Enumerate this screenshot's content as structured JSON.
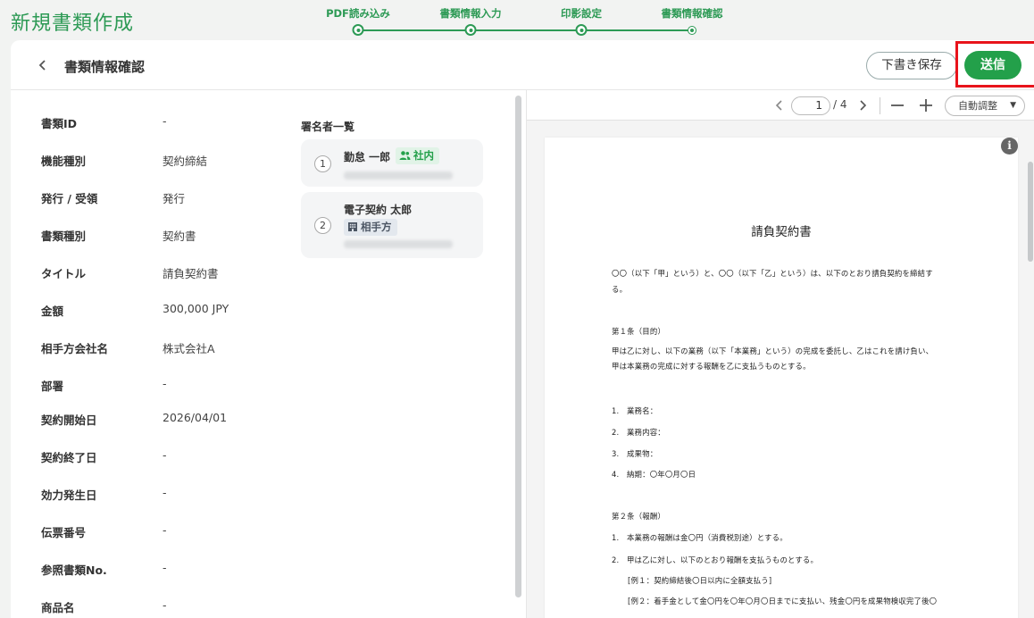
{
  "app": {
    "title": "新規書類作成"
  },
  "stepper": {
    "steps": [
      {
        "label": "PDF読み込み"
      },
      {
        "label": "書類情報入力"
      },
      {
        "label": "印影設定"
      },
      {
        "label": "書類情報確認"
      }
    ],
    "current": 4
  },
  "header": {
    "back_icon": "chevron-left-icon",
    "title": "書類情報確認",
    "draft_label": "下書き保存",
    "send_label": "送信",
    "send_highlight_color": "#e8131b"
  },
  "fields": [
    {
      "label": "書類ID",
      "value": "-"
    },
    {
      "label": "機能種別",
      "value": "契約締結"
    },
    {
      "label": "発行 / 受領",
      "value": "発行"
    },
    {
      "label": "書類種別",
      "value": "契約書"
    },
    {
      "label": "タイトル",
      "value": "請負契約書"
    },
    {
      "label": "金額",
      "value": "300,000 JPY"
    },
    {
      "label": "相手方会社名",
      "value": "株式会社A"
    },
    {
      "label": "部署",
      "value": "-"
    },
    {
      "label": "契約開始日",
      "value": "2026/04/01"
    },
    {
      "label": "契約終了日",
      "value": "-"
    },
    {
      "label": "効力発生日",
      "value": "-"
    },
    {
      "label": "伝票番号",
      "value": "-"
    },
    {
      "label": "参照書類No.",
      "value": "-"
    },
    {
      "label": "商品名",
      "value": "-"
    }
  ],
  "signers": {
    "title": "署名者一覧",
    "items": [
      {
        "number": "1",
        "name": "勤怠 一郎",
        "badge": "社内",
        "badge_icon": "people-icon"
      },
      {
        "number": "2",
        "name": "電子契約 太郎",
        "badge": "相手方",
        "badge_icon": "building-icon"
      }
    ]
  },
  "viewer": {
    "page_current": "1",
    "page_total": "/ 4",
    "zoom_label": "自動調整",
    "document": {
      "title": "請負契約書",
      "lines": [
        "〇〇（以下「甲」という）と、〇〇（以下「乙」という）は、以下のとおり請負契約を締結す",
        "る。",
        "第１条（目的）",
        "甲は乙に対し、以下の業務（以下「本業務」という）の完成を委託し、乙はこれを請け負い、",
        "甲は本業務の完成に対する報酬を乙に支払うものとする。",
        "1.　業務名：",
        "2.　業務内容：",
        "3.　成果物：",
        "4.　納期：〇年〇月〇日",
        "第２条（報酬）",
        "1.　本業務の報酬は金〇円（消費税別途）とする。",
        "2.　甲は乙に対し、以下のとおり報酬を支払うものとする。",
        "[例１：契約締結後〇日以内に全額支払う]",
        "[例２：着手金として金〇円を〇年〇月〇日までに支払い、残金〇円を成果物検収完了後〇"
      ]
    }
  }
}
